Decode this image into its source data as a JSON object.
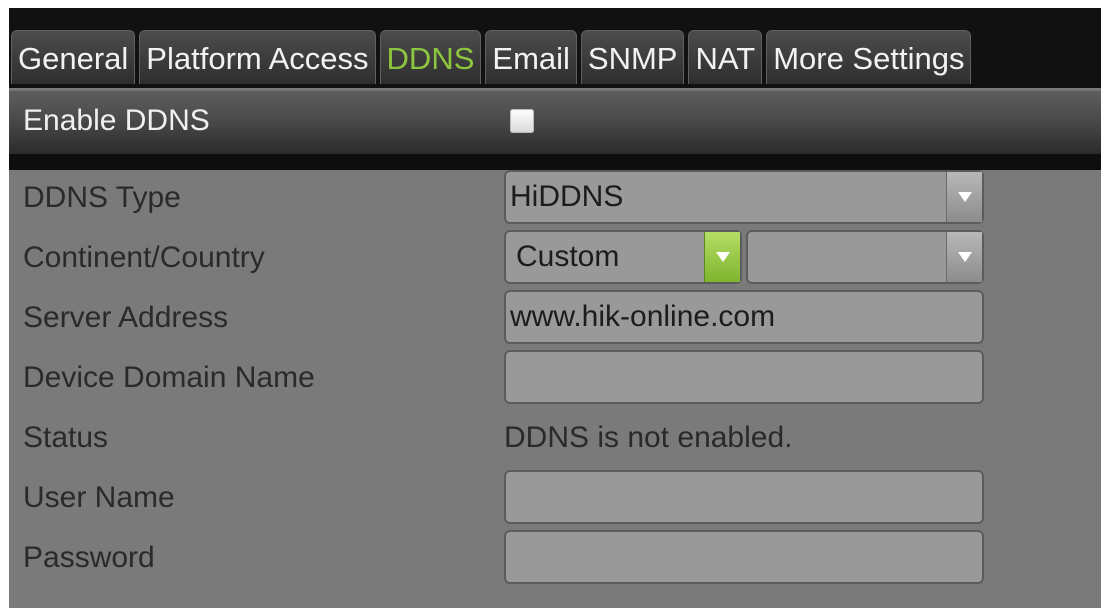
{
  "tabs": [
    {
      "label": "General",
      "active": false
    },
    {
      "label": "Platform Access",
      "active": false
    },
    {
      "label": "DDNS",
      "active": true
    },
    {
      "label": "Email",
      "active": false
    },
    {
      "label": "SNMP",
      "active": false
    },
    {
      "label": "NAT",
      "active": false
    },
    {
      "label": "More Settings",
      "active": false
    }
  ],
  "enable": {
    "label": "Enable DDNS",
    "checked": false
  },
  "form": {
    "ddns_type": {
      "label": "DDNS Type",
      "value": "HiDDNS"
    },
    "continent": {
      "label": "Continent/Country",
      "value": "Custom",
      "sub_value": ""
    },
    "server_address": {
      "label": "Server Address",
      "value": "www.hik-online.com"
    },
    "device_domain": {
      "label": "Device Domain Name",
      "value": ""
    },
    "status": {
      "label": "Status",
      "value": "DDNS is not enabled."
    },
    "user_name": {
      "label": "User Name",
      "value": ""
    },
    "password": {
      "label": "Password",
      "value": ""
    }
  },
  "colors": {
    "active_tab": "#8cc63f",
    "panel_bg": "#7a7a7a",
    "field_bg": "#999999",
    "accent_button": "#8cc63f"
  }
}
